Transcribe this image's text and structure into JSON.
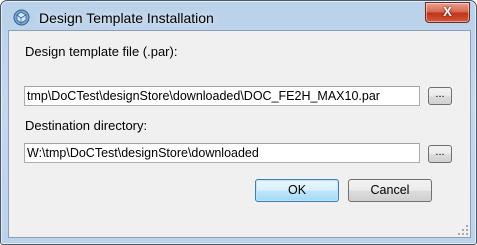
{
  "window": {
    "title": "Design Template Installation",
    "close_label": "X"
  },
  "form": {
    "template_label": "Design template file (.par):",
    "template_value": "tmp\\DoCTest\\designStore\\downloaded\\DOC_FE2H_MAX10.par",
    "dest_label": "Destination directory:",
    "dest_value": "W:\\tmp\\DoCTest\\designStore\\downloaded",
    "browse_label": "..."
  },
  "buttons": {
    "ok": "OK",
    "cancel": "Cancel"
  },
  "colors": {
    "titlebar": "#bcd3ea",
    "client": "#f0f0f0",
    "close_button": "#c1331a",
    "default_button_border": "#3c7fb1"
  }
}
